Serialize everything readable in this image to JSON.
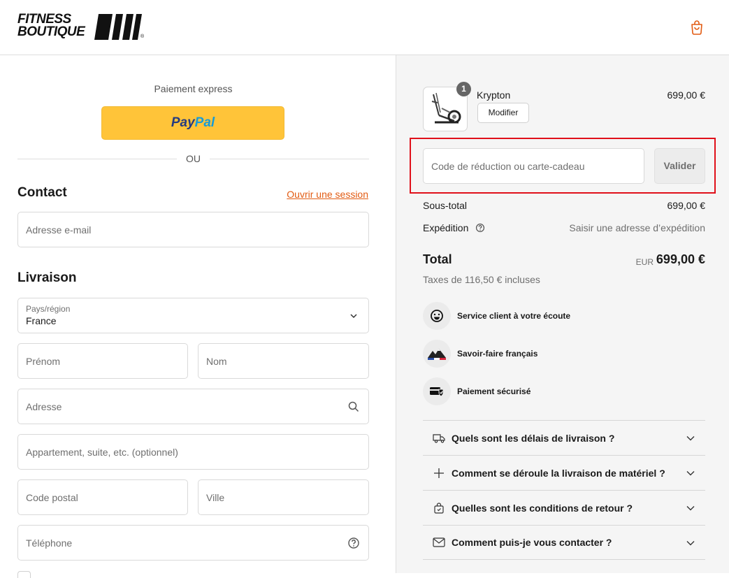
{
  "header": {
    "logo_line1": "FITNESS",
    "logo_line2": "BOUTIQUE",
    "logo_reg": "®",
    "cart_icon": "shopping-bag-icon",
    "accent_color": "#e25b12"
  },
  "express": {
    "label": "Paiement express",
    "paypal_part1": "Pay",
    "paypal_part2": "Pal",
    "separator": "OU"
  },
  "contact": {
    "title": "Contact",
    "login_link": "Ouvrir une session",
    "email_placeholder": "Adresse e-mail"
  },
  "delivery": {
    "title": "Livraison",
    "country_label": "Pays/région",
    "country_value": "France",
    "first_name_placeholder": "Prénom",
    "last_name_placeholder": "Nom",
    "address_placeholder": "Adresse",
    "apartment_placeholder": "Appartement, suite, etc. (optionnel)",
    "postal_code_placeholder": "Code postal",
    "city_placeholder": "Ville",
    "phone_placeholder": "Téléphone"
  },
  "summary": {
    "product": {
      "name": "Krypton",
      "quantity": "1",
      "price": "699,00 €",
      "modify_label": "Modifier"
    },
    "discount_placeholder": "Code de réduction ou carte-cadeau",
    "validate_label": "Valider",
    "subtotal_label": "Sous-total",
    "subtotal_value": "699,00 €",
    "shipping_label": "Expédition",
    "shipping_value": "Saisir une adresse d’expédition",
    "total_label": "Total",
    "total_currency": "EUR",
    "total_value": "699,00 €",
    "taxes": "Taxes de 116,50 € incluses"
  },
  "trust": [
    {
      "label": "Service client à votre écoute",
      "icon": "smiley-icon"
    },
    {
      "label": "Savoir-faire français",
      "icon": "french-mountains-icon"
    },
    {
      "label": "Paiement sécurisé",
      "icon": "secure-payment-icon"
    }
  ],
  "faq": [
    {
      "question": "Quels sont les délais de livraison ?",
      "icon": "delivery-truck-icon"
    },
    {
      "question": "Comment se déroule la livraison de matériel ?",
      "icon": "plus-icon"
    },
    {
      "question": "Quelles sont les conditions de retour ?",
      "icon": "return-bag-icon"
    },
    {
      "question": "Comment puis-je vous contacter ?",
      "icon": "envelope-icon"
    }
  ]
}
